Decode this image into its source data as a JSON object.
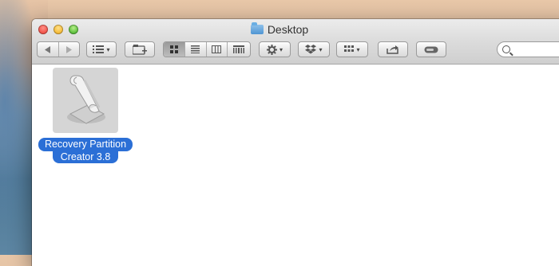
{
  "window": {
    "title": "Desktop"
  },
  "toolbar": {
    "view_icon_label": "▦",
    "view_list_label": "≣",
    "view_columns_label": "▥",
    "view_coverflow_label": "▤",
    "action_caret": "▾",
    "search_placeholder": ""
  },
  "files": [
    {
      "name_line1": "Recovery Partition",
      "name_line2": "Creator 3.8",
      "icon": "script-icon"
    }
  ]
}
